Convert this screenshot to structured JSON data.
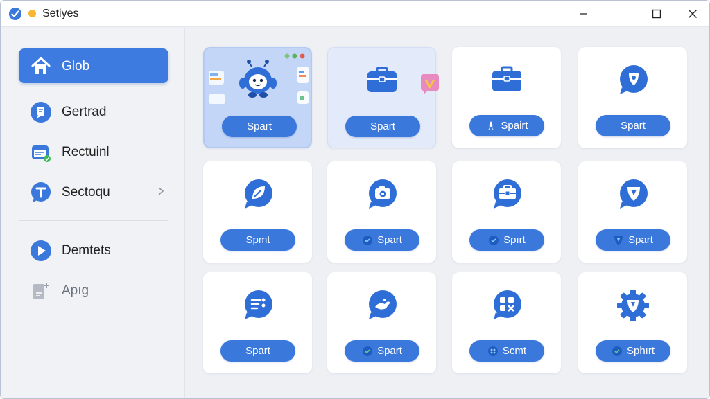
{
  "window": {
    "title": "Setiyes"
  },
  "sidebar": {
    "items": [
      {
        "label": "Glob",
        "icon": "home-icon",
        "active": true
      },
      {
        "label": "Gertrad",
        "icon": "document-chat-icon"
      },
      {
        "label": "Rectuinl",
        "icon": "calendar-check-icon"
      },
      {
        "label": "Sectoqu",
        "icon": "chat-t-icon",
        "chevron": true
      },
      {
        "label": "Demtets",
        "icon": "play-circle-icon"
      },
      {
        "label": "Apıg",
        "icon": "file-add-icon",
        "muted": true
      }
    ]
  },
  "grid": {
    "cards": [
      {
        "button": "Spart",
        "icon": "robot-icon",
        "style": "highlighted"
      },
      {
        "button": "Spart",
        "icon": "briefcase-icon",
        "style": "soft"
      },
      {
        "button": "Spairt",
        "icon": "briefcase-icon",
        "button_glyph": "rocket-icon"
      },
      {
        "button": "Spart",
        "icon": "chat-shield-icon"
      },
      {
        "button": "Spmt",
        "icon": "chat-leaf-icon"
      },
      {
        "button": "Spart",
        "icon": "camera-chat-icon",
        "button_glyph": "check-badge-icon"
      },
      {
        "button": "Spırt",
        "icon": "toolbox-chat-icon",
        "button_glyph": "check-badge-icon"
      },
      {
        "button": "Spart",
        "icon": "shield-chat-icon",
        "button_glyph": "shield-badge-icon"
      },
      {
        "button": "Spart",
        "icon": "list-chat-icon"
      },
      {
        "button": "Spart",
        "icon": "bird-chat-icon",
        "button_glyph": "check-badge-icon"
      },
      {
        "button": "Scmt",
        "icon": "apps-chat-icon",
        "button_glyph": "grid-badge-icon"
      },
      {
        "button": "Sphırt",
        "icon": "gear-shield-icon",
        "button_glyph": "check-badge-icon"
      }
    ]
  },
  "colors": {
    "accent": "#3b78dc",
    "sidebar_active": "#3d7be0",
    "status_dot": "#f7b733"
  }
}
